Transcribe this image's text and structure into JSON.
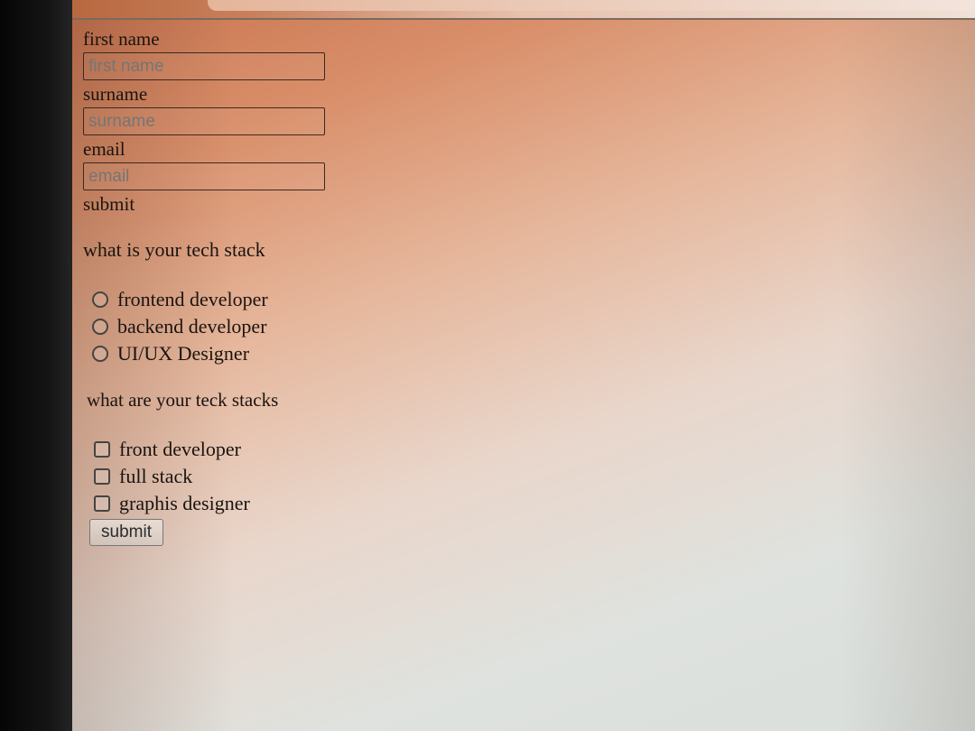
{
  "form": {
    "first_name_label": "first name",
    "first_name_placeholder": "first name",
    "surname_label": "surname",
    "surname_placeholder": "surname",
    "email_label": "email",
    "email_placeholder": "email",
    "submit_text": "submit"
  },
  "tech_stack": {
    "question": "what is your tech stack",
    "options": [
      "frontend developer",
      "backend developer",
      "UI/UX Designer"
    ]
  },
  "teck_stacks": {
    "question": "what are your teck stacks",
    "options": [
      "front developer",
      "full stack",
      "graphis designer"
    ]
  },
  "submit_button": {
    "label": "submit"
  }
}
